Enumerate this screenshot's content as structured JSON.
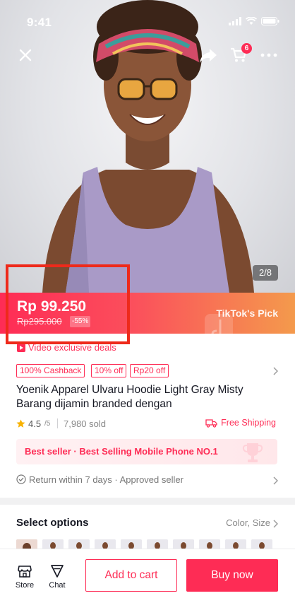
{
  "status_bar": {
    "time": "9:41"
  },
  "header": {
    "cart_count": "6",
    "image_counter": "2/8"
  },
  "price": {
    "current": "Rp 99.250",
    "original": "Rp295.000",
    "discount": "-55%",
    "badge": "TikTok's Pick"
  },
  "deals": {
    "label": "Video exclusive deals"
  },
  "coupons": [
    "100% Cashback",
    "10% off",
    "Rp20 off"
  ],
  "product": {
    "title": "Yoenik Apparel Ulvaru Hoodie Light Gray Misty Barang dijamin branded dengan"
  },
  "rating": {
    "value": "4.5",
    "max": "/5",
    "sold": "7,980 sold"
  },
  "shipping": {
    "label": "Free Shipping"
  },
  "bestseller": {
    "label": "Best seller · Best Selling Mobile Phone  NO.1"
  },
  "return_policy": {
    "label": "Return within 7 days · Approved seller"
  },
  "options": {
    "title": "Select options",
    "summary": "Color, Size"
  },
  "bottom_bar": {
    "store_label": "Store",
    "chat_label": "Chat",
    "add_to_cart": "Add to cart",
    "buy_now": "Buy now"
  },
  "colors": {
    "brand": "#fe2c55",
    "highlight": "#ee2a1b",
    "gradient_end": "#f49a4c"
  }
}
